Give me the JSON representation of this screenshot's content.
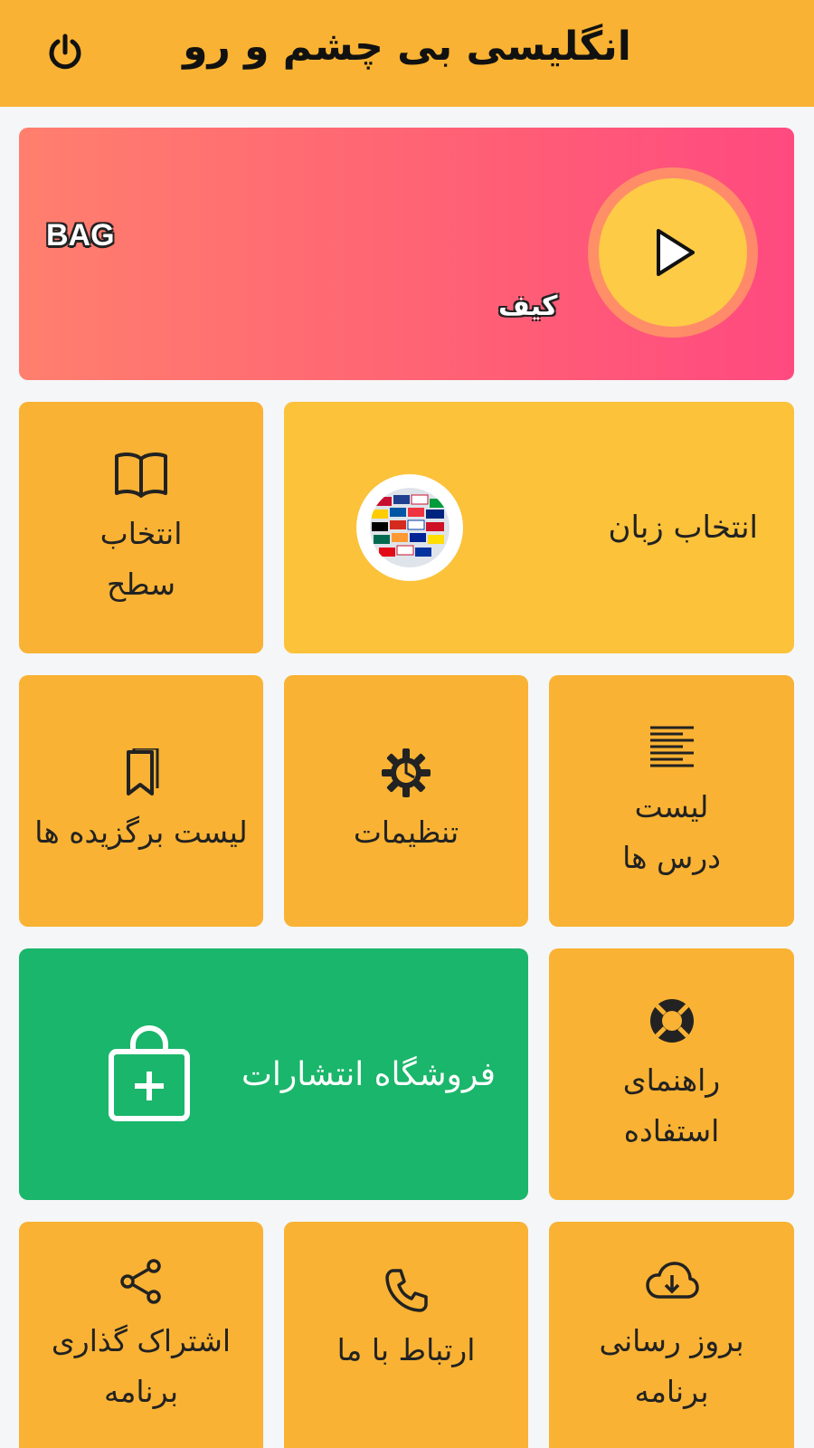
{
  "header": {
    "title": "انگلیسی بی چشم و رو",
    "power_icon": "power-icon"
  },
  "banner": {
    "word_en": "BAG",
    "word_fa": "کیف",
    "play_icon": "play-icon"
  },
  "tiles": {
    "select_level": {
      "line1": "انتخاب",
      "line2": "سطح",
      "icon": "book-icon"
    },
    "select_language": {
      "label": "انتخاب زبان",
      "icon": "globe-flags-icon"
    },
    "favorites": {
      "label": "لیست برگزیده ها",
      "icon": "bookmark-icon"
    },
    "settings": {
      "label": "تنظیمات",
      "icon": "gear-icon"
    },
    "lessons": {
      "line1": "لیست",
      "line2": "درس ها",
      "icon": "list-icon"
    },
    "store": {
      "label": "فروشگاه انتشارات",
      "icon": "shopping-bag-plus-icon"
    },
    "guide": {
      "line1": "راهنمای",
      "line2": "استفاده",
      "icon": "lifebuoy-icon"
    },
    "share": {
      "line1": "اشتراک گذاری",
      "line2": "برنامه",
      "icon": "share-icon"
    },
    "contact": {
      "label": "ارتباط با ما",
      "icon": "phone-icon"
    },
    "update": {
      "line1": "بروز رسانی",
      "line2": "برنامه",
      "icon": "cloud-download-icon"
    }
  },
  "colors": {
    "header": "#f9b233",
    "tile": "#f9b233",
    "language_tile": "#fbc23a",
    "store_tile": "#1ab66b",
    "banner_start": "#ff7f6e",
    "banner_end": "#ff4a80",
    "play_circle": "#fdcb46"
  }
}
